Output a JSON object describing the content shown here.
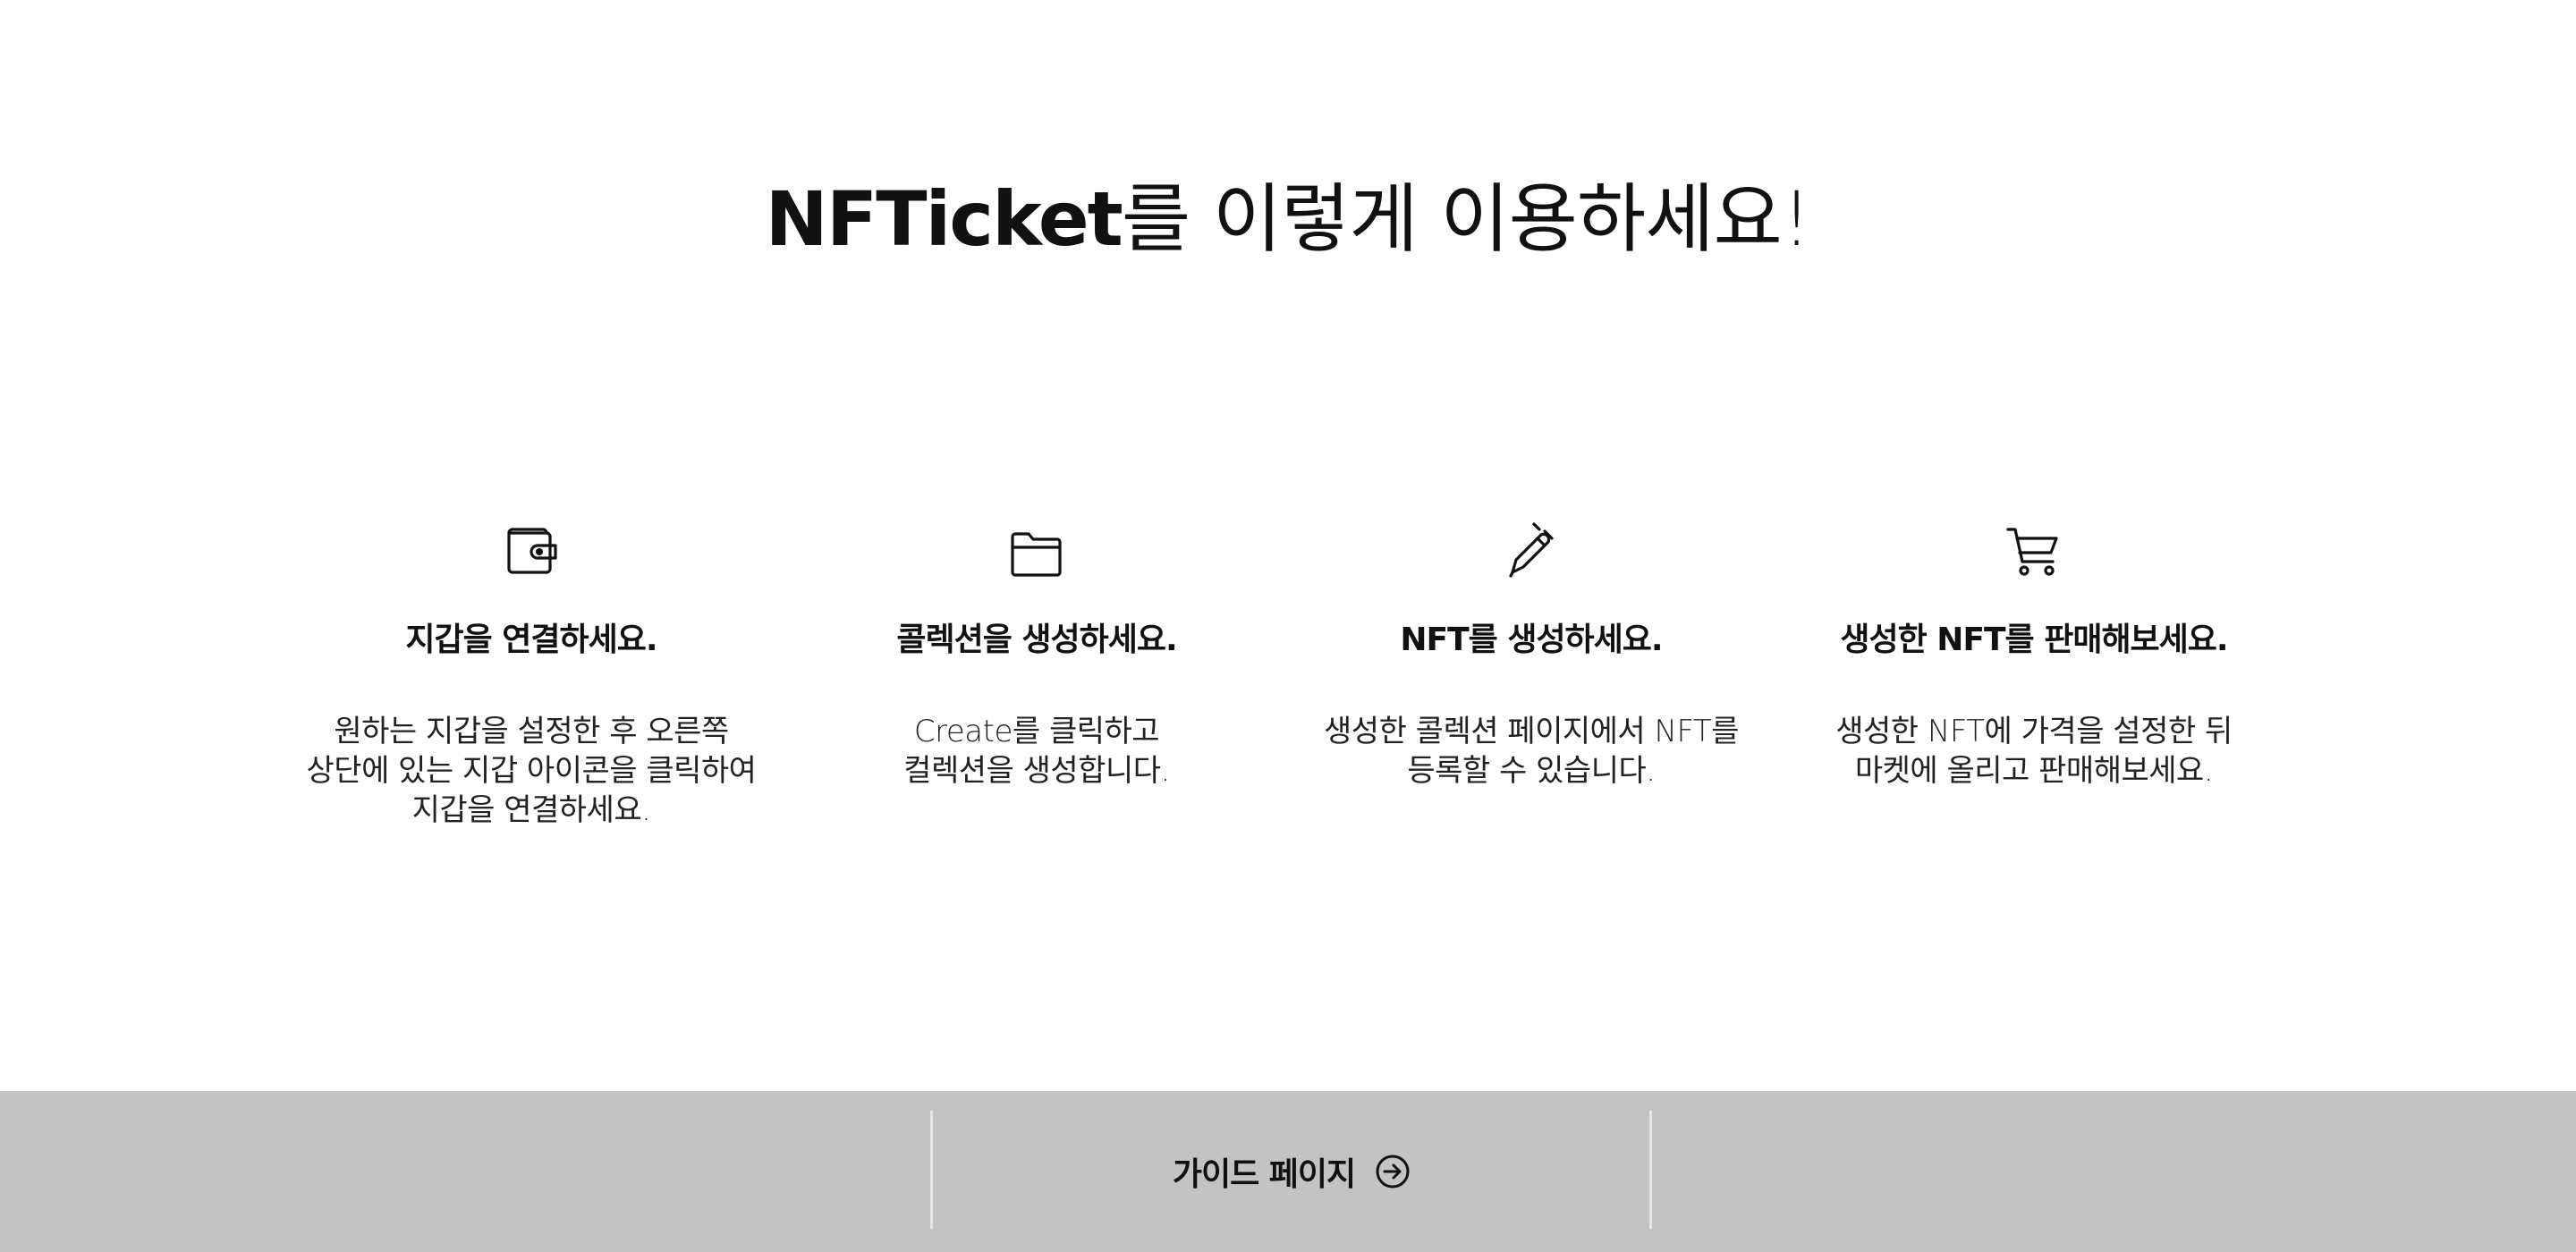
{
  "hero": {
    "brand": "NFTicket",
    "rest": "를 이렇게 이용하세요!"
  },
  "steps": [
    {
      "icon": "wallet-icon",
      "title": "지갑을 연결하세요.",
      "description": "원하는 지갑을 설정한 후 오른쪽\n상단에 있는 지갑 아이콘을 클릭하여\n지갑을 연결하세요."
    },
    {
      "icon": "folder-icon",
      "title": "콜렉션을 생성하세요.",
      "description": "Create를 클릭하고\n컬렉션을 생성합니다."
    },
    {
      "icon": "pen-icon",
      "title": "NFT를 생성하세요.",
      "description": "생성한 콜렉션 페이지에서 NFT를\n등록할 수 있습니다."
    },
    {
      "icon": "cart-icon",
      "title": "생성한 NFT를 판매해보세요.",
      "description": "생성한 NFT에 가격을 설정한 뒤\n마켓에 올리고 판매해보세요."
    }
  ],
  "footer": {
    "guide_label": "가이드 페이지",
    "guide_icon": "arrow-circle-right-icon",
    "background": "#c3c3c3"
  }
}
